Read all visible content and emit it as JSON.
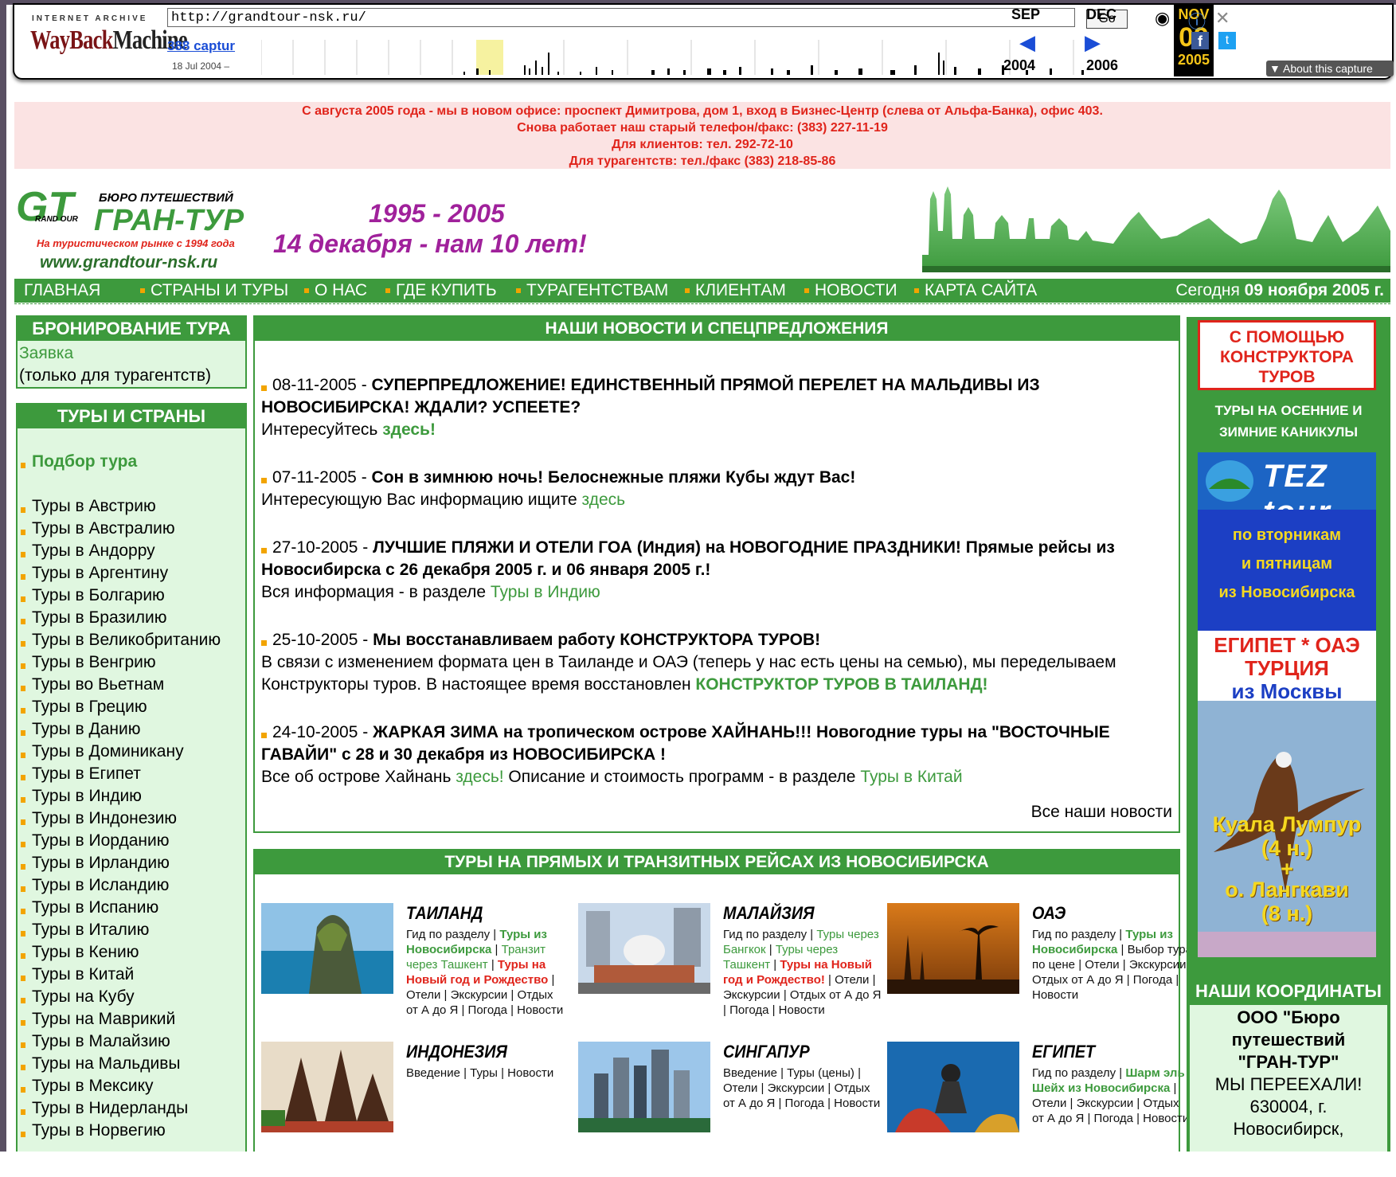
{
  "wayback": {
    "ia_label": "INTERNET ARCHIVE",
    "logo_way": "WayBack",
    "logo_machine": "Machine",
    "url": "http://grandtour-nsk.ru/",
    "go_label": "Go",
    "captures_label": "388 captur",
    "capture_date": "18 Jul 2004 –",
    "prev_month": "SEP",
    "cur_month": "NOV",
    "next_month": "DEC",
    "cur_day": "09",
    "prev_year": "2004",
    "cur_year": "2005",
    "next_year": "2006",
    "about_label": "About this capture"
  },
  "notice": {
    "line1": "С августа 2005 года - мы в новом офисе: проспект Димитрова, дом 1, вход в Бизнес-Центр (слева от Альфа-Банка), офис 403.",
    "line2": "Снова работает наш старый телефон/факс: (383) 227-11-19",
    "line3": "Для клиентов: тел. 292-72-10",
    "line4": "Для турагентств: тел./факс (383) 218-85-86"
  },
  "header": {
    "logo_gt": "GT",
    "logo_grand": "RAND OUR",
    "logo_bureau": "БЮРО ПУТЕШЕСТВИЙ",
    "logo_name": "ГРАН-ТУР",
    "logo_sub": "На туристическом рынке с 1994 года",
    "logo_www": "www.grandtour-nsk.ru",
    "years": "1995 - 2005",
    "anniversary": "14 декабря - нам 10 лет!"
  },
  "nav": {
    "items": [
      "ГЛАВНАЯ",
      "СТРАНЫ И ТУРЫ",
      "О НАС",
      "ГДЕ КУПИТЬ",
      "ТУРАГЕНТСТВАМ",
      "КЛИЕНТАМ",
      "НОВОСТИ",
      "КАРТА САЙТА"
    ],
    "today_label": "Сегодня",
    "today_date": "09 ноября 2005 г."
  },
  "booking": {
    "title": "БРОНИРОВАНИЕ ТУРА",
    "link": "Заявка",
    "note": "(только для турагентств)"
  },
  "tours_sidebar": {
    "title": "ТУРЫ И СТРАНЫ",
    "selection": "Подбор тура",
    "countries": [
      "Туры в Австрию",
      "Туры в Австралию",
      "Туры в Андорру",
      "Туры в Аргентину",
      "Туры в Болгарию",
      "Туры в Бразилию",
      "Туры в Великобританию",
      "Туры в Венгрию",
      "Туры во Вьетнам",
      "Туры в Грецию",
      "Туры в Данию",
      "Туры в Доминикану",
      "Туры в Египет",
      "Туры в Индию",
      "Туры в Индонезию",
      "Туры в Иорданию",
      "Туры в Ирландию",
      "Туры в Исландию",
      "Туры в Испанию",
      "Туры в Италию",
      "Туры в Кению",
      "Туры в Китай",
      "Туры на Кубу",
      "Туры на Маврикий",
      "Туры в Малайзию",
      "Туры на Мальдивы",
      "Туры в Мексику",
      "Туры в Нидерланды",
      "Туры в Норвегию"
    ]
  },
  "news": {
    "title": "НАШИ НОВОСТИ И СПЕЦПРЕДЛОЖЕНИЯ",
    "items": [
      {
        "date": "08-11-2005",
        "sep": " - ",
        "headline": "СУПЕРПРЕДЛОЖЕНИЕ! ЕДИНСТВЕННЫЙ ПРЯМОЙ ПЕРЕЛЕТ НА МАЛЬДИВЫ ИЗ НОВОСИБИРСКА! ЖДАЛИ? УСПЕЕТЕ?",
        "text": "Интересуйтесь ",
        "link": "здесь!",
        "text2": ""
      },
      {
        "date": "07-11-2005",
        "sep": " - ",
        "headline": "Сон в зимнюю ночь! Белоснежные пляжи Кубы ждут Вас!",
        "text": "Интересующую Вас информацию ищите ",
        "link": "здесь",
        "text2": ""
      },
      {
        "date": "27-10-2005",
        "sep": " - ",
        "headline": "ЛУЧШИЕ ПЛЯЖИ И ОТЕЛИ ГОА (Индия) на НОВОГОДНИЕ ПРАЗДНИКИ! Прямые рейсы из Новосибирска с 26 декабря 2005 г. и 06 января 2005 г.!",
        "text": "Вся информация - в разделе ",
        "link": "Туры в Индию",
        "text2": ""
      },
      {
        "date": "25-10-2005",
        "sep": " - ",
        "headline": "Мы восстанавливаем работу КОНСТРУКТОРА ТУРОВ!",
        "text": "В связи с изменением формата цен в Таиланде и ОАЭ (теперь у нас есть цены на семью), мы переделываем Конструкторы туров. В настоящее время восстановлен ",
        "link": "КОНСТРУКТОР ТУРОВ В ТАИЛАНД!",
        "text2": ""
      },
      {
        "date": "24-10-2005",
        "sep": " - ",
        "headline": "ЖАРКАЯ ЗИМА на тропическом острове ХАЙНАНЬ!!! Новогодние туры на \"ВОСТОЧНЫЕ ГАВАЙИ\" с 28 и 30 декабря из НОВОСИБИРСКА !",
        "text": "Все об острове Хайнань ",
        "link": "здесь!",
        "text2": " Описание и стоимость программ - в разделе ",
        "link2": "Туры в Китай"
      }
    ],
    "all_news": "Все наши новости"
  },
  "direct_tours": {
    "title": "ТУРЫ НА ПРЯМЫХ И ТРАНЗИТНЫХ РЕЙСАХ ИЗ НОВОСИБИРСКА",
    "items": [
      {
        "name": "ТАИЛАНД",
        "p1": "Гид по разделу | ",
        "g1": "Туры из Новосибирска",
        "p2": " | ",
        "t1": "Транзит через Ташкент",
        "p3": " | ",
        "r1": "Туры на Новый год и Рождество",
        "p4": " | Отели | Экскурсии | Отдых от А до Я | Погода | Новости"
      },
      {
        "name": "МАЛАЙЗИЯ",
        "p1": "Гид по разделу | ",
        "g1": "Туры через Бангкок",
        "p2": " | ",
        "t1": "Туры через Ташкент",
        "p3": " | ",
        "r1": "Туры на Новый год и Рождество!",
        "p4": " | Отели | Экскурсии | Отдых от А до Я | Погода | Новости"
      },
      {
        "name": "ОАЭ",
        "p1": "Гид по разделу | ",
        "g1": "Туры из Новосибирска",
        "p2": " | Выбор тура по цене | Отели | Экскурсии | Отдых от А до Я | Погода | Новости",
        "t1": "",
        "p3": "",
        "r1": "",
        "p4": ""
      },
      {
        "name": "ИНДОНЕЗИЯ",
        "p1": "Введение | Туры | Новости",
        "g1": "",
        "p2": "",
        "t1": "",
        "p3": "",
        "r1": "",
        "p4": ""
      },
      {
        "name": "СИНГАПУР",
        "p1": "Введение | Туры (цены) | Отели | Экскурсии | Отдых от А до Я | Погода | Новости",
        "g1": "",
        "p2": "",
        "t1": "",
        "p3": "",
        "r1": "",
        "p4": ""
      },
      {
        "name": "ЕГИПЕТ",
        "p1": "Гид по разделу | ",
        "g1": "Шарм эль Шейх из Новосибирска",
        "p2": " | Отели | Экскурсии | Отдых от А до Я | Погода | Новости",
        "t1": "",
        "p3": "",
        "r1": "",
        "p4": ""
      }
    ]
  },
  "right": {
    "constructor": "С ПОМОЩЬЮ КОНСТРУКТОРА ТУРОВ",
    "holidays": "ТУРЫ НА ОСЕННИЕ И ЗИМНИЕ КАНИКУЛЫ",
    "tez": "TEZ tour",
    "days1": "по вторникам",
    "days2": "и пятницам",
    "days3": "из Новосибирска",
    "egypt1": "ЕГИПЕТ * ОАЭ",
    "egypt2": "ТУРЦИЯ",
    "egypt3": "из Москвы",
    "kl1": "Куала Лумпур",
    "kl2": "(4 н.)",
    "kl3": "+",
    "kl4": "о. Лангкави",
    "kl5": "(8 н.)",
    "coord_title": "НАШИ КООРДИНАТЫ",
    "coord1": "ООО \"Бюро",
    "coord2": "путешествий",
    "coord3": "\"ГРАН-ТУР\"",
    "coord4": "МЫ ПЕРЕЕХАЛИ!",
    "coord5": "630004, г.",
    "coord6": "Новосибирск,"
  },
  "colors": {
    "green": "#3d9a3d",
    "light_green": "#e0f7e0",
    "red": "#e0241b",
    "orange_bullet": "#f2a400",
    "purple": "#a0219b"
  }
}
